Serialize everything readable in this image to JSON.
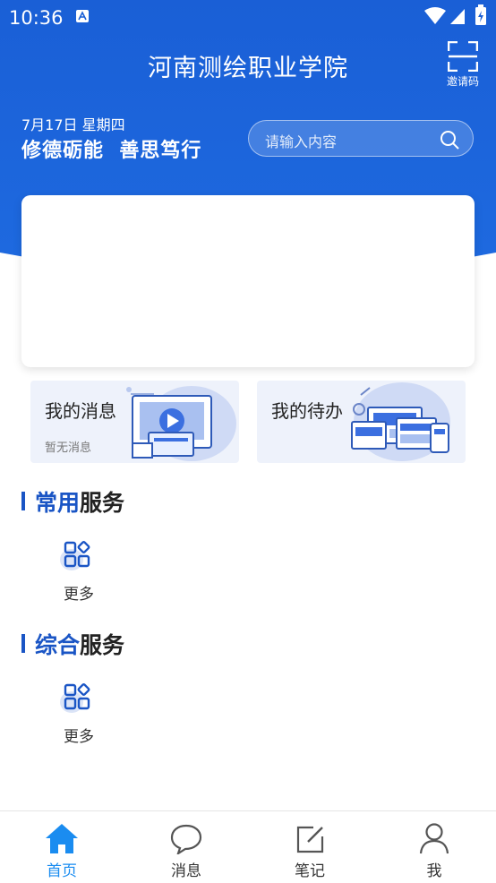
{
  "status_bar": {
    "time": "10:36"
  },
  "header": {
    "title": "河南测绘职业学院",
    "invite_label": "邀请码",
    "date": "7月17日 星期四",
    "motto": "修德砺能  善思笃行",
    "search_placeholder": "请输入内容"
  },
  "quick_cards": [
    {
      "title": "我的消息",
      "subtitle": "暂无消息"
    },
    {
      "title": "我的待办"
    }
  ],
  "sections": [
    {
      "title_highlight": "常用",
      "title_rest": "服务",
      "items": [
        {
          "label": "更多",
          "icon": "grid-icon"
        }
      ]
    },
    {
      "title_highlight": "综合",
      "title_rest": "服务",
      "items": [
        {
          "label": "更多",
          "icon": "grid-icon"
        }
      ]
    }
  ],
  "tab_bar": {
    "tabs": [
      {
        "label": "首页",
        "icon": "home-icon",
        "active": true
      },
      {
        "label": "消息",
        "icon": "chat-icon"
      },
      {
        "label": "笔记",
        "icon": "edit-icon"
      },
      {
        "label": "我",
        "icon": "user-icon"
      }
    ]
  },
  "colors": {
    "primary": "#1a5fd6",
    "accent": "#1a55c5",
    "tab_active": "#1a8cf0",
    "card_bg": "#eef2fb"
  }
}
